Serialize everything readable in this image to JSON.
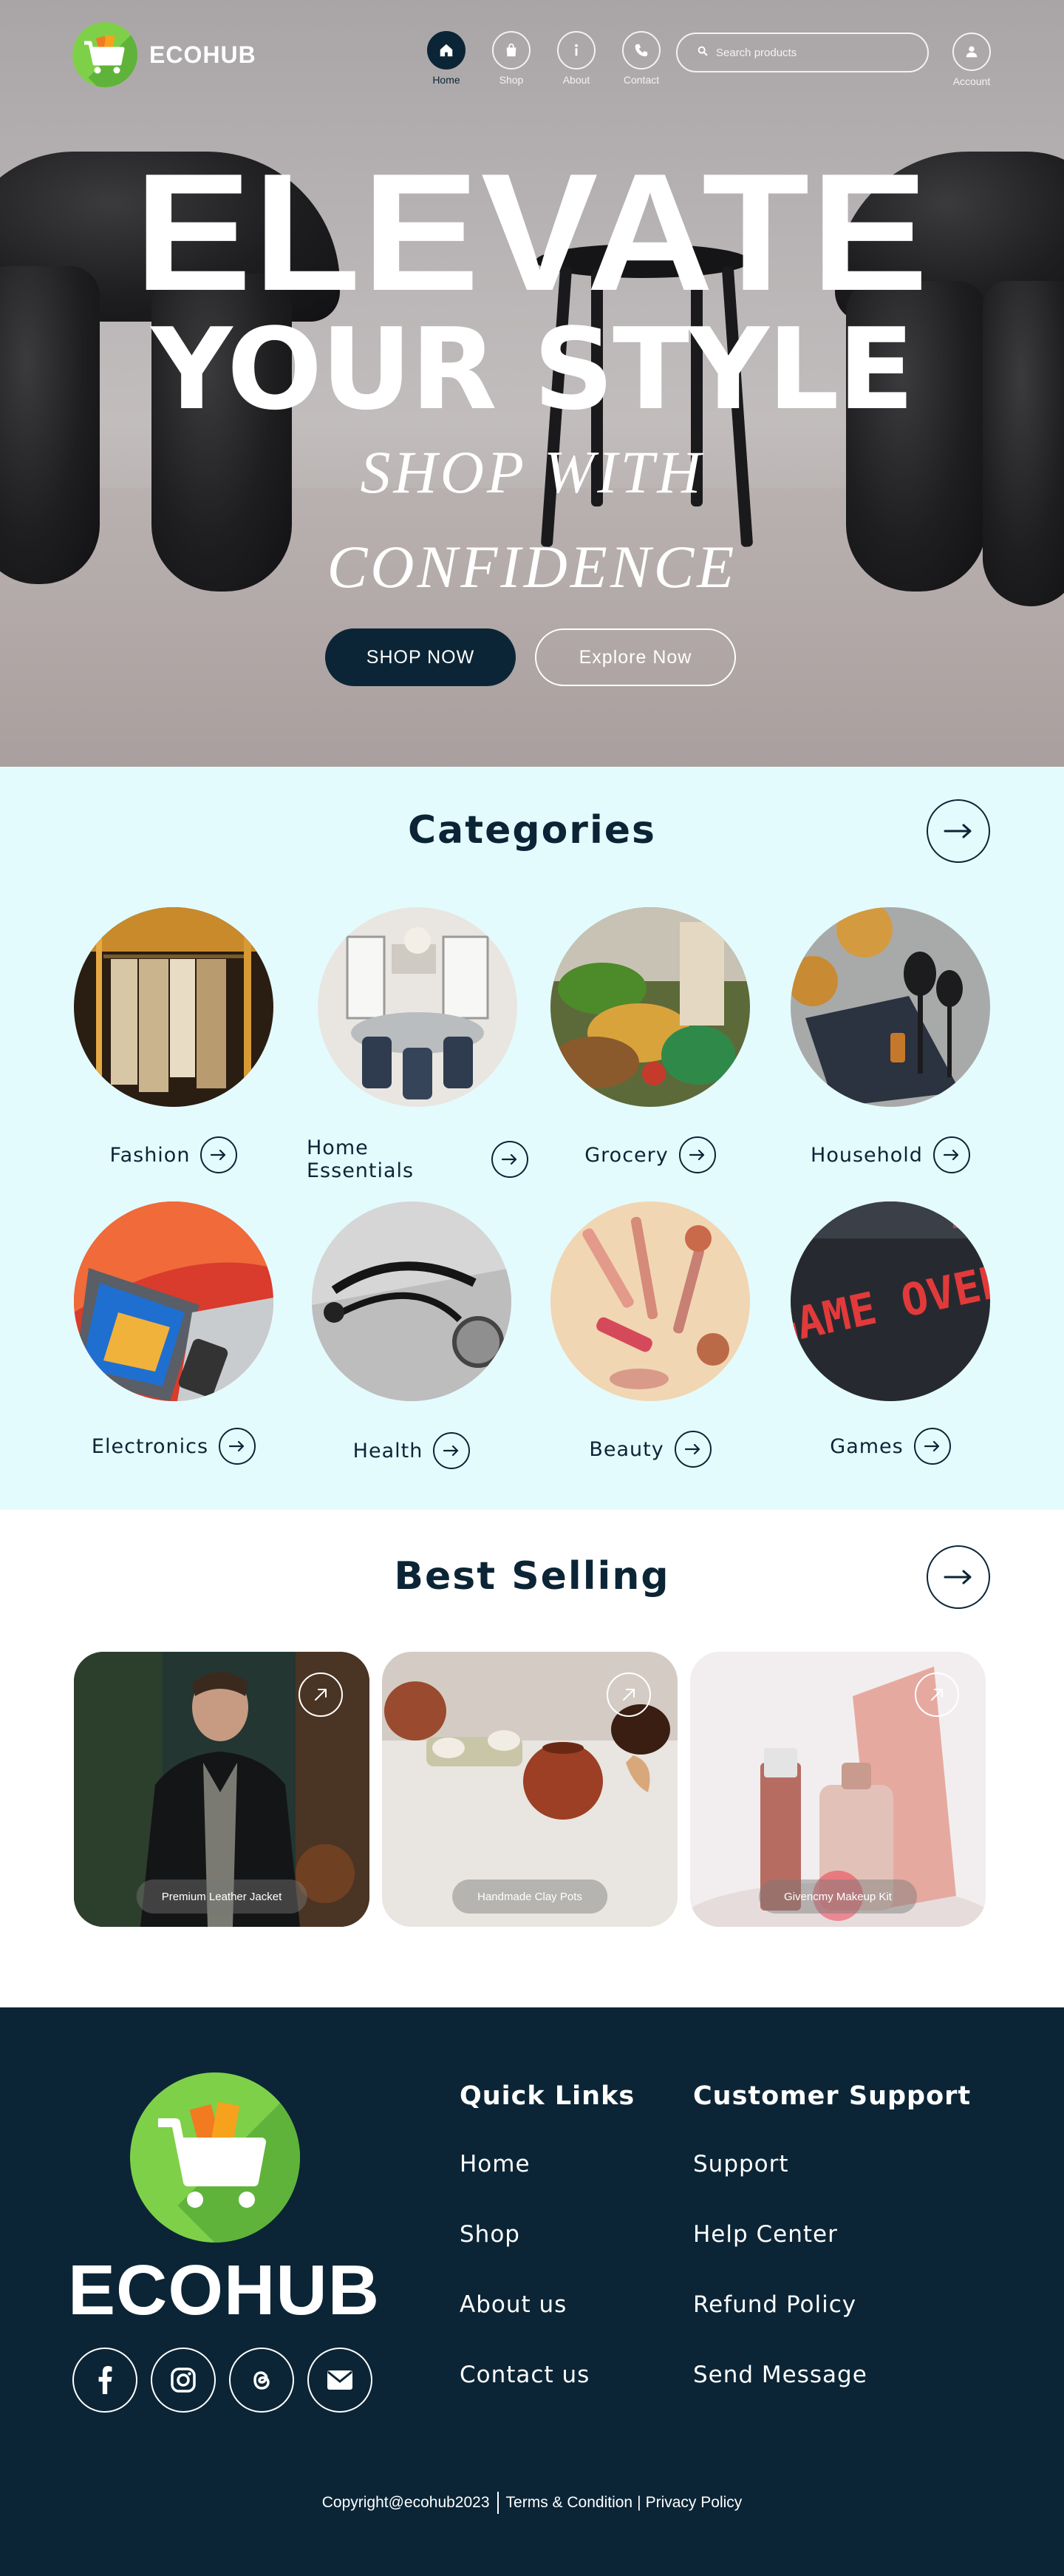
{
  "brand": {
    "name": "ECOHUB",
    "logo_color": "#7fd049"
  },
  "nav": {
    "items": [
      {
        "label": "Home",
        "icon": "home-icon",
        "active": true
      },
      {
        "label": "Shop",
        "icon": "shopping-bag-icon",
        "active": false
      },
      {
        "label": "About",
        "icon": "info-icon",
        "active": false
      },
      {
        "label": "Contact",
        "icon": "phone-icon",
        "active": false
      }
    ],
    "search_placeholder": "Search products",
    "account_label": "Account"
  },
  "hero": {
    "line1": "ELEVATE",
    "line2": "YOUR STYLE",
    "line3": "SHOP WITH",
    "line4": "CONFIDENCE",
    "primary_button": "SHOP NOW",
    "secondary_button": "Explore Now"
  },
  "categories": {
    "title": "Categories",
    "items": [
      {
        "label": "Fashion"
      },
      {
        "label": "Home Essentials"
      },
      {
        "label": "Grocery"
      },
      {
        "label": "Household"
      },
      {
        "label": "Electronics"
      },
      {
        "label": "Health"
      },
      {
        "label": "Beauty"
      },
      {
        "label": "Games"
      }
    ]
  },
  "best_selling": {
    "title": "Best Selling",
    "items": [
      {
        "label": "Premium Leather Jacket"
      },
      {
        "label": "Handmade Clay Pots"
      },
      {
        "label": "Givencmy Makeup Kit"
      }
    ]
  },
  "footer": {
    "brand": "ECOHUB",
    "socials": [
      "facebook-icon",
      "instagram-icon",
      "threads-icon",
      "mail-icon"
    ],
    "quick_links": {
      "title": "Quick Links",
      "links": [
        "Home",
        "Shop",
        "About us",
        "Contact us"
      ]
    },
    "support": {
      "title": "Customer Support",
      "links": [
        "Support",
        "Help Center",
        "Refund Policy",
        "Send Message"
      ]
    },
    "copyright": "Copyright@ecohub2023",
    "terms": "Terms & Condition",
    "divider": "|",
    "privacy": "Privacy Policy"
  },
  "colors": {
    "navy": "#0b2536",
    "mint": "#e4fbfd",
    "green": "#7fd049"
  }
}
